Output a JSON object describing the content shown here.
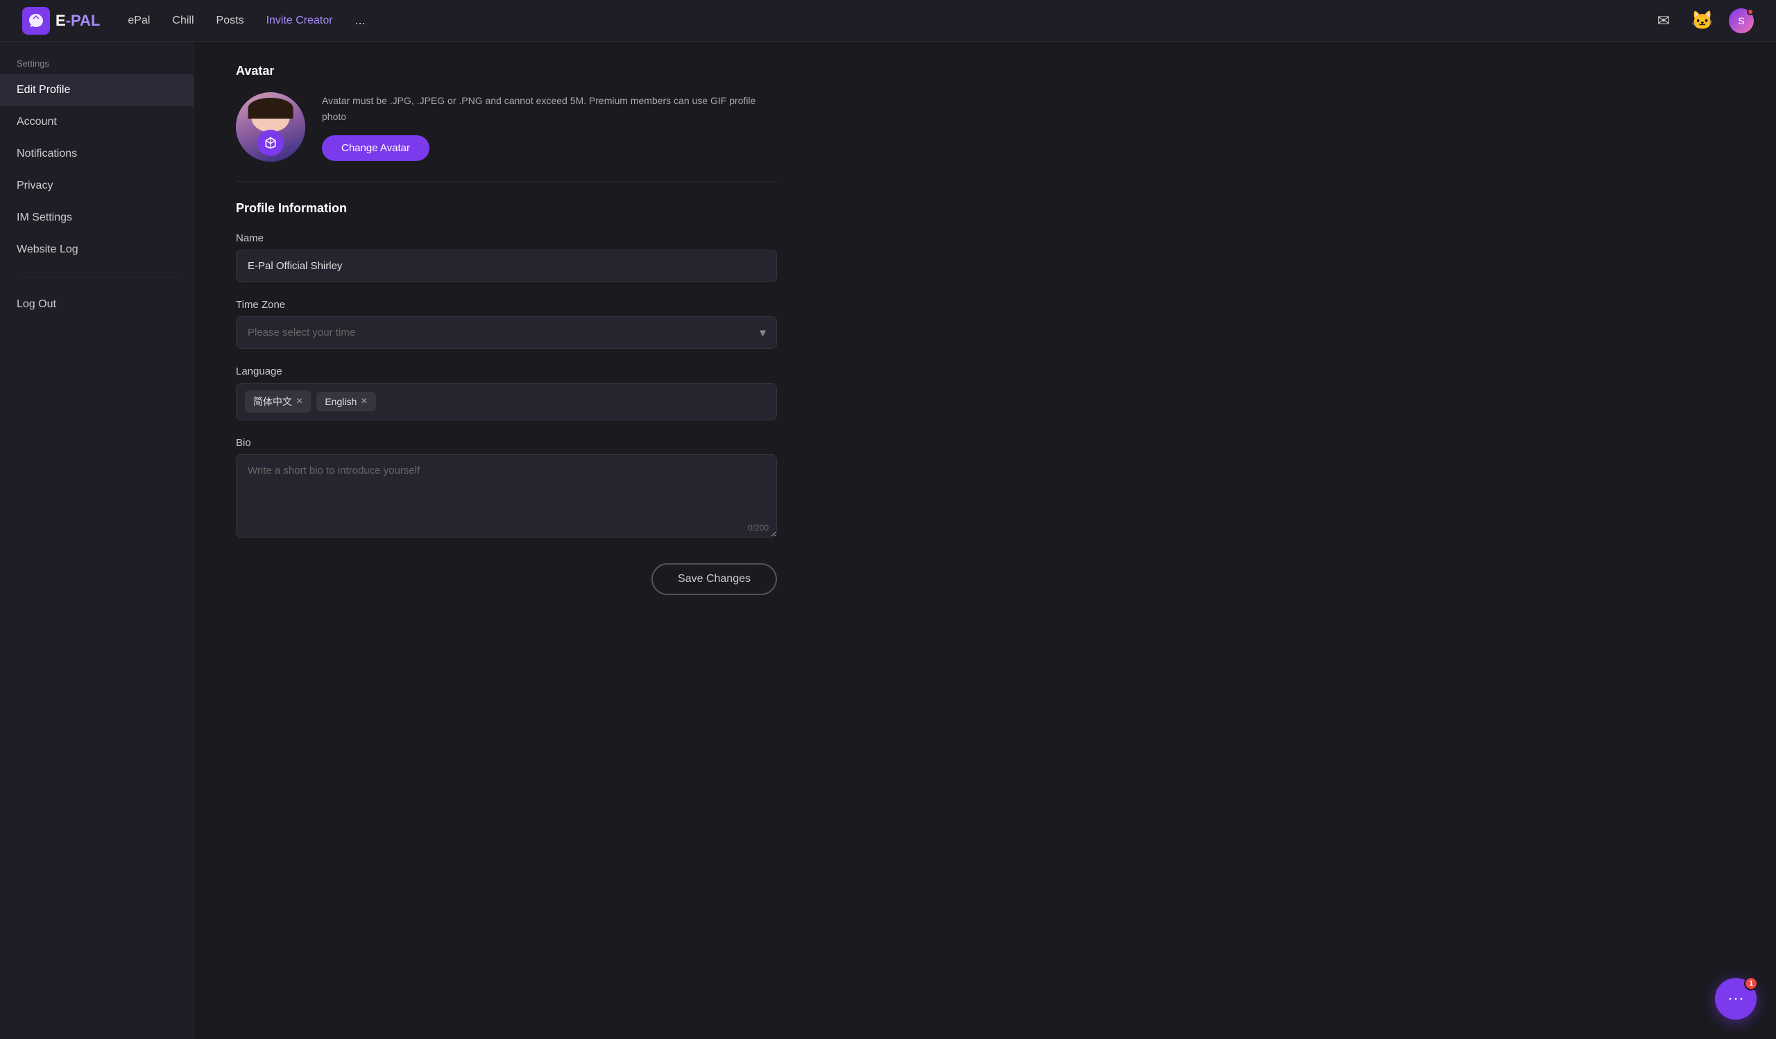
{
  "brand": {
    "logo_icon": "🐱",
    "logo_text_e": "E",
    "logo_text_pal": "-PAL"
  },
  "navbar": {
    "links": [
      {
        "label": "ePal",
        "active": false
      },
      {
        "label": "Chill",
        "active": false
      },
      {
        "label": "Posts",
        "active": false
      },
      {
        "label": "Invite Creator",
        "active": true
      },
      {
        "label": "...",
        "active": false
      }
    ],
    "mail_icon": "✉",
    "mascot_icon": "🐱",
    "avatar_text": "S",
    "avatar_badge": "1"
  },
  "sidebar": {
    "settings_label": "Settings",
    "items": [
      {
        "label": "Edit Profile",
        "active": true
      },
      {
        "label": "Account",
        "active": false
      },
      {
        "label": "Notifications",
        "active": false
      },
      {
        "label": "Privacy",
        "active": false
      },
      {
        "label": "IM Settings",
        "active": false
      },
      {
        "label": "Website Log",
        "active": false
      }
    ],
    "logout_label": "Log Out"
  },
  "avatar_section": {
    "title": "Avatar",
    "rules": "Avatar must be .JPG, .JPEG or .PNG and cannot exceed 5M.\nPremium members can use GIF profile photo",
    "change_btn": "Change Avatar"
  },
  "profile_info": {
    "title": "Profile Information",
    "name_label": "Name",
    "name_value": "E-Pal Official Shirley",
    "timezone_label": "Time Zone",
    "timezone_placeholder": "Please select your time",
    "language_label": "Language",
    "languages": [
      {
        "label": "简体中文",
        "removable": true
      },
      {
        "label": "English",
        "removable": true
      }
    ],
    "bio_label": "Bio",
    "bio_placeholder": "Write a short bio to introduce yourself",
    "bio_counter": "0/200"
  },
  "footer": {
    "save_btn": "Save Changes"
  },
  "chat_widget": {
    "badge": "1",
    "icon": "···"
  }
}
